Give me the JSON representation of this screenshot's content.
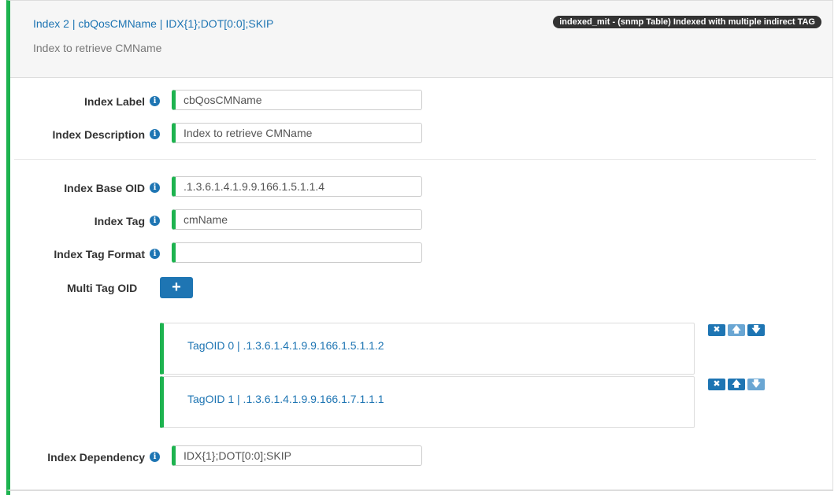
{
  "header": {
    "title": "Index 2 | cbQosCMName | IDX{1};DOT[0:0];SKIP",
    "subtitle": "Index to retrieve CMName",
    "badge": "indexed_mit - (snmp Table) Indexed with multiple indirect TAG"
  },
  "fields": {
    "index_label": {
      "label": "Index Label",
      "value": "cbQosCMName"
    },
    "index_description": {
      "label": "Index Description",
      "value": "Index to retrieve CMName"
    },
    "index_base_oid": {
      "label": "Index Base OID",
      "value": ".1.3.6.1.4.1.9.9.166.1.5.1.1.4"
    },
    "index_tag": {
      "label": "Index Tag",
      "value": "cmName"
    },
    "index_tag_format": {
      "label": "Index Tag Format",
      "value": ""
    },
    "index_dependency": {
      "label": "Index Dependency",
      "value": "IDX{1};DOT[0:0];SKIP"
    }
  },
  "multi_tag": {
    "label": "Multi Tag OID",
    "add_label": "+",
    "items": [
      {
        "title": "TagOID 0 | .1.3.6.1.4.1.9.9.166.1.5.1.1.2"
      },
      {
        "title": "TagOID 1 | .1.3.6.1.4.1.9.9.166.1.7.1.1.1"
      }
    ]
  },
  "icons": {
    "info": "info-icon",
    "remove": "close-icon",
    "up": "arrow-up-icon",
    "down": "arrow-down-icon"
  },
  "colors": {
    "accent_green": "#1db34f",
    "link_blue": "#1e75b3",
    "badge_dark": "#333333"
  }
}
